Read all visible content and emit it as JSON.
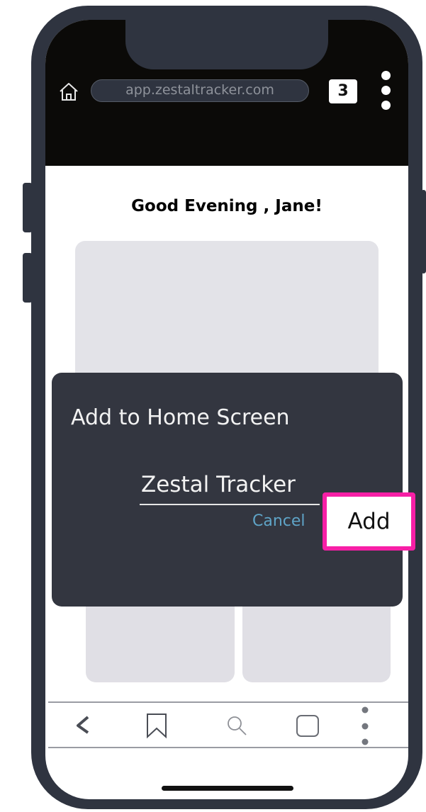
{
  "browser": {
    "url": "app.zestaltracker.com",
    "tab_count": "3"
  },
  "page": {
    "greeting": "Good Evening , Jane!"
  },
  "dialog": {
    "title": "Add to Home Screen",
    "app_name_value": "Zestal Tracker",
    "cancel_label": "Cancel",
    "add_label": "Add"
  },
  "bottom_nav": {
    "icons": [
      "back-icon",
      "bookmark-icon",
      "search-icon",
      "tabs-icon",
      "more-icon"
    ]
  },
  "colors": {
    "frame": "#2f3440",
    "dialog_bg": "#333640",
    "cancel": "#5fa4c7",
    "highlight": "#f71fa6"
  }
}
